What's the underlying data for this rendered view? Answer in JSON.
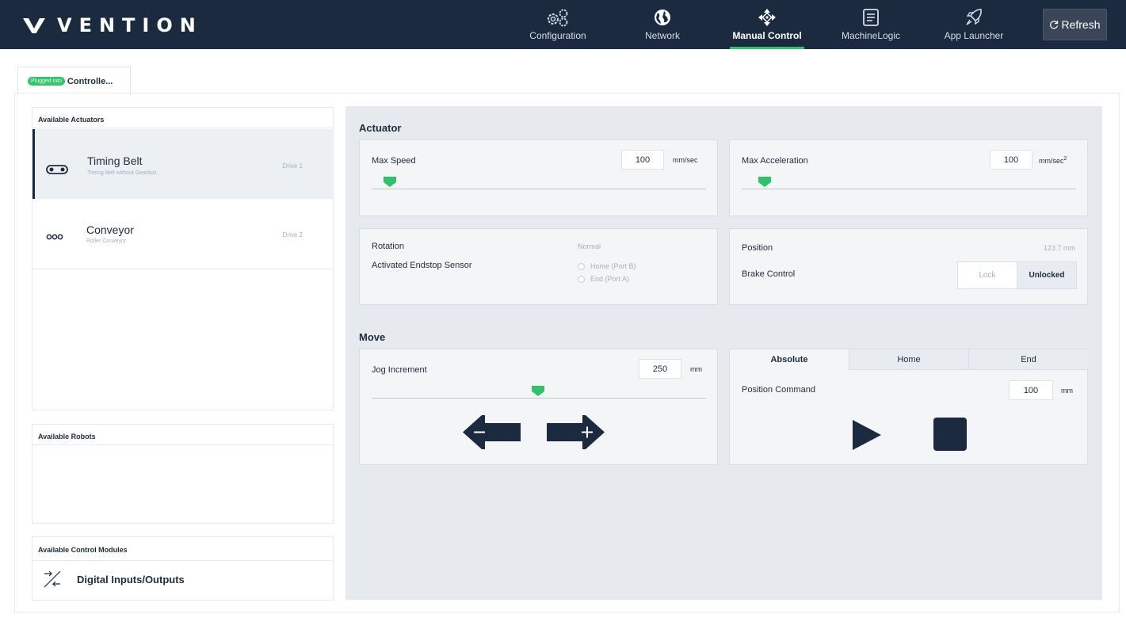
{
  "app": {
    "brand": "VENTION"
  },
  "nav": {
    "items": [
      {
        "label": "Configuration",
        "icon": "gears-icon"
      },
      {
        "label": "Network",
        "icon": "globe-icon"
      },
      {
        "label": "Manual Control",
        "icon": "move-arrows-icon",
        "active": true
      },
      {
        "label": "MachineLogic",
        "icon": "program-list-icon"
      },
      {
        "label": "App Launcher",
        "icon": "rocket-icon"
      }
    ],
    "refresh_label": "Refresh"
  },
  "controller_tab": {
    "badge": "Plugged into",
    "label": "Controlle..."
  },
  "sidebar": {
    "actuators_header": "Available Actuators",
    "actuators": [
      {
        "title": "Timing Belt",
        "subtitle": "Timing Belt without Gearbox",
        "drive": "Drive 1",
        "selected": true
      },
      {
        "title": "Conveyor",
        "subtitle": "Roller Conveyor",
        "drive": "Drive 2",
        "selected": false
      }
    ],
    "robots_header": "Available Robots",
    "modules_header": "Available Control Modules",
    "modules": [
      {
        "label": "Digital Inputs/Outputs",
        "icon": "io-arrows-icon"
      }
    ]
  },
  "actuator": {
    "section_title": "Actuator",
    "max_speed": {
      "label": "Max Speed",
      "value": "100",
      "unit": "mm/sec",
      "slider_level": 0.05
    },
    "max_accel": {
      "label": "Max Acceleration",
      "value": "100",
      "unit": "mm/sec",
      "unit_sup": "2",
      "slider_level": 0.05
    },
    "rotation": {
      "label": "Rotation",
      "value": "Normal"
    },
    "endstop": {
      "label": "Activated Endstop Sensor",
      "options": [
        "Home (Port B)",
        "End (Port A)"
      ]
    },
    "position": {
      "label": "Position",
      "value": "123.7 mm"
    },
    "brake": {
      "label": "Brake Control",
      "lock_label": "Lock",
      "unlocked_label": "Unlocked",
      "state": "Unlocked"
    }
  },
  "move": {
    "section_title": "Move",
    "jog": {
      "label": "Jog Increment",
      "value": "250",
      "unit": "mm",
      "slider_level": 0.5
    },
    "tabs": [
      "Absolute",
      "Home",
      "End"
    ],
    "active_tab": "Absolute",
    "position_command": {
      "label": "Position Command",
      "value": "100",
      "unit": "mm"
    }
  },
  "colors": {
    "accent": "#2cc36b",
    "nav_bg": "#1b2a3e",
    "panel_bg": "#e6eaee"
  }
}
